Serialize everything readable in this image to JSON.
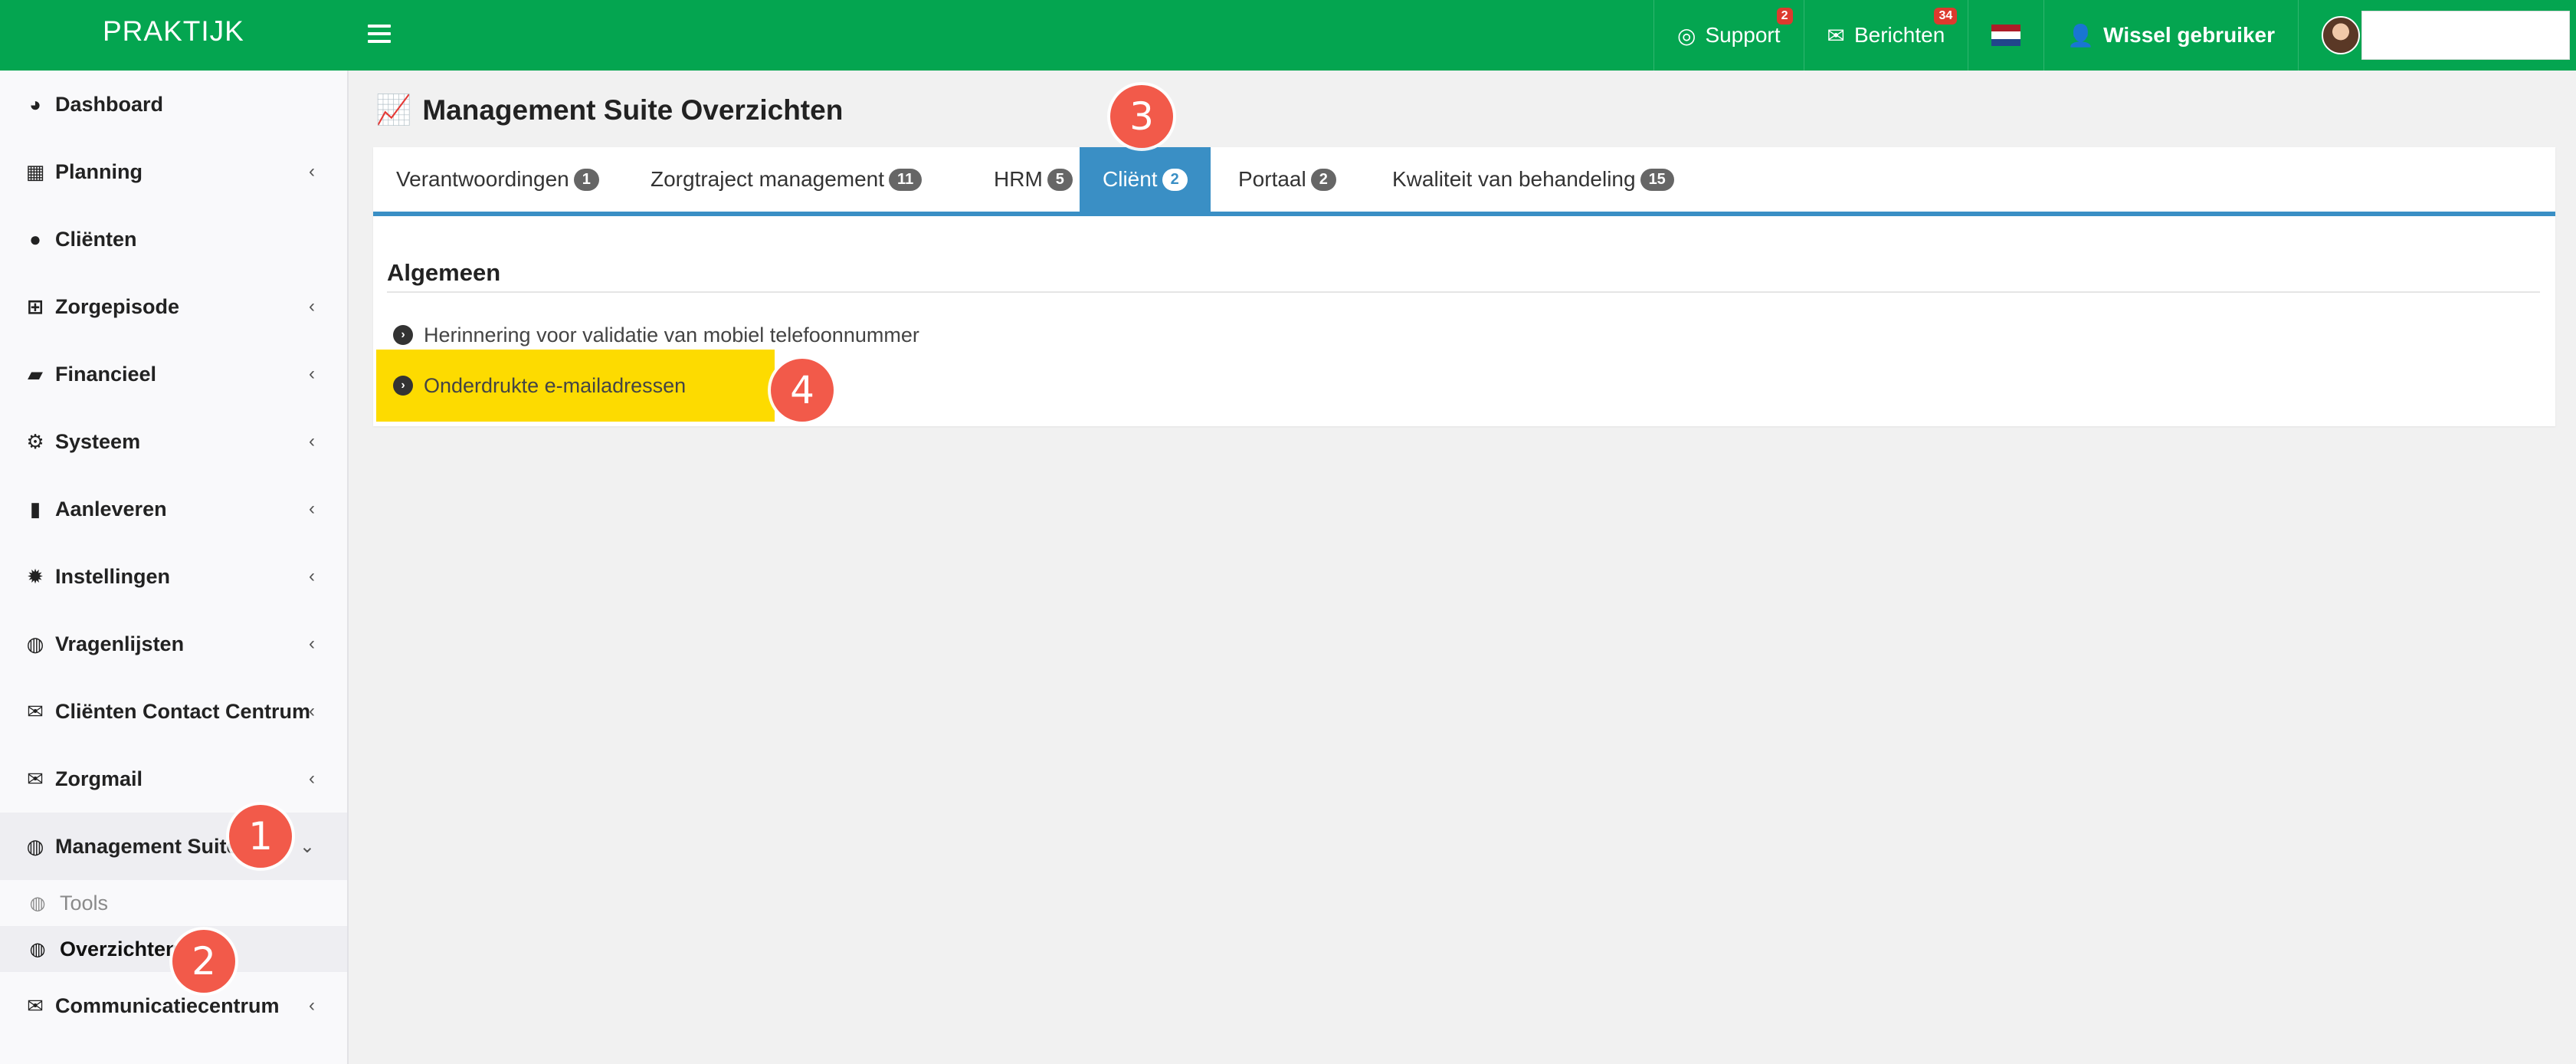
{
  "app": {
    "brand": "PRAKTIJK"
  },
  "topbar": {
    "support": {
      "label": "Support",
      "badge": "2"
    },
    "messages": {
      "label": "Berichten",
      "badge": "34"
    },
    "switch_user": {
      "label": "Wissel gebruiker"
    },
    "flag_colors": [
      "#ae1c28",
      "#ffffff",
      "#21468b"
    ]
  },
  "sidebar": {
    "items": [
      {
        "label": "Dashboard",
        "icon": "dashboard-icon",
        "has_submenu": false
      },
      {
        "label": "Planning",
        "icon": "calendar-icon",
        "has_submenu": true
      },
      {
        "label": "Cliënten",
        "icon": "user-icon",
        "has_submenu": false
      },
      {
        "label": "Zorgepisode",
        "icon": "medkit-icon",
        "has_submenu": true
      },
      {
        "label": "Financieel",
        "icon": "book-icon",
        "has_submenu": true
      },
      {
        "label": "Systeem",
        "icon": "cogs-icon",
        "has_submenu": true
      },
      {
        "label": "Aanleveren",
        "icon": "truck-icon",
        "has_submenu": true
      },
      {
        "label": "Instellingen",
        "icon": "gear-icon",
        "has_submenu": true
      },
      {
        "label": "Vragenlijsten",
        "icon": "globe-icon",
        "has_submenu": true
      },
      {
        "label": "Cliënten Contact Centrum",
        "icon": "envelope-icon",
        "has_submenu": true
      },
      {
        "label": "Zorgmail",
        "icon": "envelope-icon",
        "has_submenu": true
      },
      {
        "label": "Management Suite",
        "icon": "globe-icon",
        "has_submenu": true,
        "expanded": true
      },
      {
        "label": "Communicatiecentrum",
        "icon": "envelope-icon",
        "has_submenu": true
      }
    ],
    "management_suite_sub": [
      {
        "label": "Tools",
        "icon": "globe-icon",
        "active": false
      },
      {
        "label": "Overzichten",
        "icon": "globe-icon",
        "active": true
      }
    ]
  },
  "main": {
    "title": "Management Suite Overzichten",
    "tabs": [
      {
        "label": "Verantwoordingen",
        "count": "1",
        "active": false
      },
      {
        "label": "Zorgtraject management",
        "count": "11",
        "active": false
      },
      {
        "label": "HRM",
        "count": "5",
        "active": false
      },
      {
        "label": "Cliënt",
        "count": "2",
        "active": true
      },
      {
        "label": "Portaal",
        "count": "2",
        "active": false
      },
      {
        "label": "Kwaliteit van behandeling",
        "count": "15",
        "active": false
      }
    ],
    "section_title": "Algemeen",
    "reports": [
      {
        "label": "Herinnering voor validatie van mobiel telefoonnummer",
        "highlighted": false
      },
      {
        "label": "Onderdrukte e-mailadressen",
        "highlighted": true
      }
    ]
  },
  "callouts": [
    "1",
    "2",
    "3",
    "4"
  ],
  "colors": {
    "topbar": "#04a550",
    "tab_active": "#3a8fc5",
    "highlight": "#fddb00",
    "callout": "#f25a4a",
    "badge": "#dd3a2e"
  }
}
